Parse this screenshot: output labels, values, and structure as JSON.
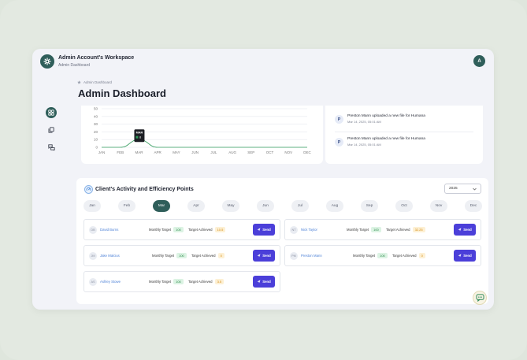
{
  "workspace": {
    "title": "Admin Account's Workspace",
    "subtitle": "Admin Dashboard"
  },
  "user": {
    "avatar_initial": "A"
  },
  "sidebar": {
    "items": [
      {
        "icon": "dashboard-icon",
        "active": true
      },
      {
        "icon": "copy-icon",
        "active": false
      },
      {
        "icon": "chat-bubbles-icon",
        "active": false
      }
    ]
  },
  "breadcrumb": {
    "label": "Admin Dashboard"
  },
  "page": {
    "title": "Admin Dashboard"
  },
  "chart_data": {
    "type": "line",
    "categories": [
      "JAN",
      "FEB",
      "MAR",
      "APR",
      "MAY",
      "JUN",
      "JUL",
      "AUG",
      "SEP",
      "OCT",
      "NOV",
      "DEC"
    ],
    "series": [
      {
        "values": [
          0,
          0,
          10,
          0,
          0,
          0,
          0,
          0,
          0,
          0,
          0,
          0
        ],
        "color": "#2f9a5a"
      }
    ],
    "yticks": [
      0,
      10,
      20,
      30,
      40,
      50
    ],
    "ylim": [
      0,
      50
    ],
    "grid": true,
    "tooltip": {
      "label": "MAR",
      "value": "8"
    }
  },
  "notifications": [
    {
      "initial": "P",
      "text": "Preston Mann uploaded a new file for Humana",
      "time": "Mar 14, 2025, 05:01 AM"
    },
    {
      "initial": "P",
      "text": "Preston Mann uploaded a new file for Humana",
      "time": "Mar 14, 2025, 05:01 AM"
    }
  ],
  "activity": {
    "title": "Client's Activity and Efficiency Points",
    "year": "2025",
    "months": [
      "Jan",
      "Feb",
      "Mar",
      "Apr",
      "May",
      "Jun",
      "Jul",
      "Aug",
      "Sep",
      "Oct",
      "Nov",
      "Dec"
    ],
    "active_month": "Mar",
    "target_label": "Monthly Target",
    "achieved_label": "Target Achieved",
    "send_label": "Send",
    "clients": [
      {
        "initials": "DB",
        "name": "David Burns",
        "target": "100",
        "achieved": "10.5"
      },
      {
        "initials": "NT",
        "name": "Nick Taylor",
        "target": "100",
        "achieved": "32.25"
      },
      {
        "initials": "JM",
        "name": "Jake Malcius",
        "target": "100",
        "achieved": "0"
      },
      {
        "initials": "PM",
        "name": "Preston Mann",
        "target": "100",
        "achieved": "0"
      },
      {
        "initials": "AS",
        "name": "Ashley Stowe",
        "target": "100",
        "achieved": "3.5"
      }
    ]
  },
  "colors": {
    "brand": "#2f5e5a",
    "send": "#4b3fd9",
    "line": "#2f9a5a",
    "link": "#4a7fd6"
  }
}
